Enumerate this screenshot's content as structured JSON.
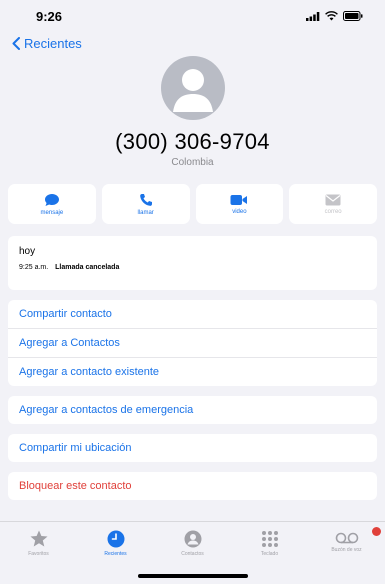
{
  "status": {
    "time": "9:26"
  },
  "nav": {
    "back_label": "Recientes"
  },
  "contact": {
    "number": "(300) 306-9704",
    "country": "Colombia"
  },
  "actions": [
    {
      "label": "mensaje",
      "icon": "message-icon"
    },
    {
      "label": "llamar",
      "icon": "phone-icon"
    },
    {
      "label": "video",
      "icon": "video-icon"
    },
    {
      "label": "correo",
      "icon": "mail-icon"
    }
  ],
  "recent": {
    "day": "hoy",
    "time": "9:25 a.m.",
    "event": "Llamada cancelada"
  },
  "options": {
    "share_contact": "Compartir contacto",
    "add_contact": "Agregar a Contactos",
    "add_existing": "Agregar a contacto existente",
    "add_emergency": "Agregar a contactos de emergencia",
    "share_location": "Compartir mi ubicación",
    "block": "Bloquear este contacto"
  },
  "tabs": [
    {
      "label": "Favoritos",
      "icon": "star-icon"
    },
    {
      "label": "Recientes",
      "icon": "clock-icon"
    },
    {
      "label": "Contactos",
      "icon": "person-circle-icon"
    },
    {
      "label": "Teclado",
      "icon": "keypad-icon"
    },
    {
      "label": "Buzón de voz",
      "icon": "voicemail-icon"
    }
  ],
  "colors": {
    "accent": "#1a73e8",
    "danger": "#e0403a",
    "background": "#f2f2f7"
  }
}
